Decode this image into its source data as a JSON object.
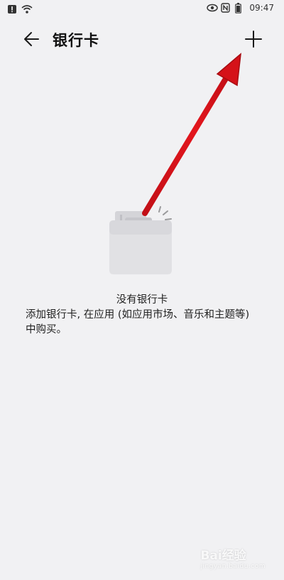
{
  "status_bar": {
    "time": "09:47",
    "icons": [
      "alert-icon",
      "wifi-icon",
      "eye-icon",
      "nfc-icon",
      "battery-icon"
    ]
  },
  "app_bar": {
    "title": "银行卡",
    "back_icon": "arrow-left-icon",
    "add_icon": "plus-icon"
  },
  "empty_state": {
    "title": "没有银行卡",
    "description": "添加银行卡, 在应用 (如应用市场、音乐和主题等) 中购买。",
    "illustration": "card-wallet-icon"
  },
  "annotation": {
    "arrow_color": "#e3161d"
  },
  "watermark": {
    "text": "Bai经验",
    "subtext": "jingyan.baidu.com"
  }
}
